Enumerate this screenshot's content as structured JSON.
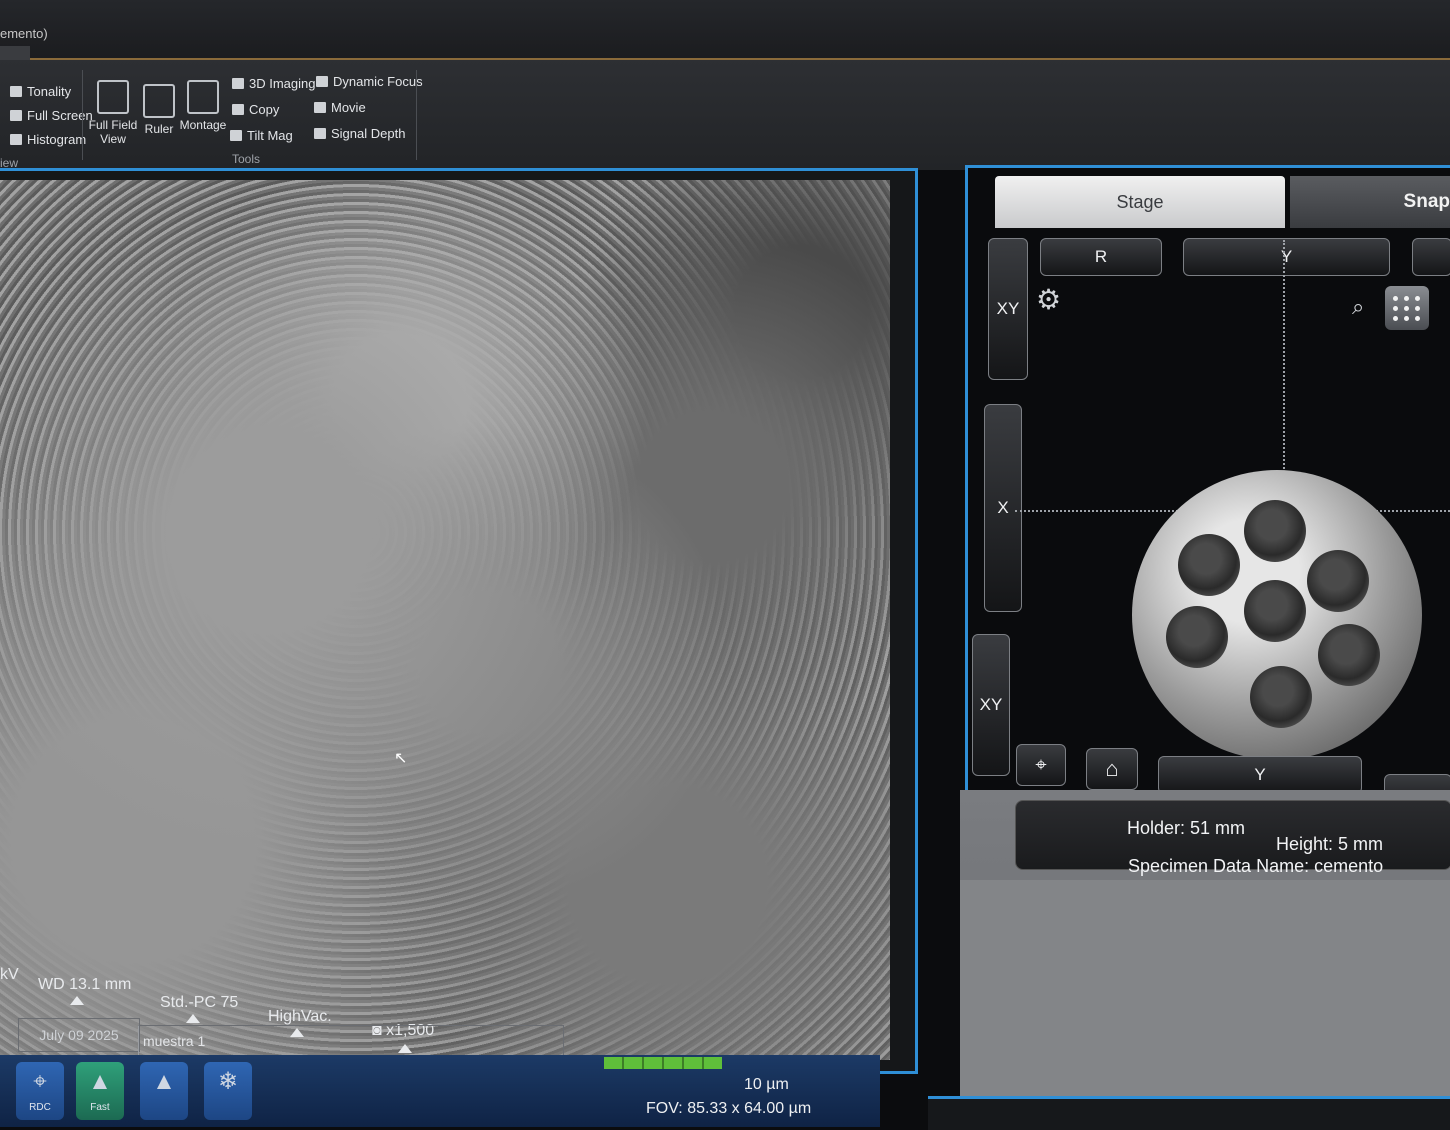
{
  "window": {
    "title": "emento)"
  },
  "ribbon": {
    "view_group": {
      "label": "iew",
      "items": [
        "Tonality",
        "Full Screen",
        "Histogram"
      ]
    },
    "tools_group": {
      "label": "Tools",
      "big_buttons": [
        "Full Field View",
        "Ruler",
        "Montage"
      ],
      "col1": [
        "3D Imaging",
        "Copy",
        "Tilt Mag"
      ],
      "col2": [
        "Dynamic Focus",
        "Movie",
        "Signal Depth"
      ]
    }
  },
  "status": {
    "kv": "kV",
    "wd": "WD 13.1 mm",
    "std": "Std.-PC 75",
    "vac": "HighVac.",
    "mag": "x1,500",
    "date": "July 09 2025",
    "name": "muestra 1",
    "scale": "10 µm",
    "fov": "FOV: 85.33 x 64.00 µm"
  },
  "toolbar": {
    "buttons": [
      {
        "label": "RDC",
        "icon": "probe-icon"
      },
      {
        "label": "Fast",
        "icon": "scan-fast-icon"
      },
      {
        "label": "",
        "icon": "scan-icon"
      },
      {
        "label": "",
        "icon": "snowflake-icon"
      }
    ]
  },
  "stage": {
    "tabs": {
      "stage": "Stage",
      "snap": "Snap"
    },
    "buttons": {
      "r": "R",
      "y_top": "Y",
      "xy_top": "XY",
      "x": "X",
      "xy_bottom": "XY",
      "y_bottom": "Y"
    },
    "info": {
      "holder": "Holder: 51 mm",
      "height": "Height: 5 mm",
      "specimen": "Specimen Data Name: cemento"
    }
  }
}
